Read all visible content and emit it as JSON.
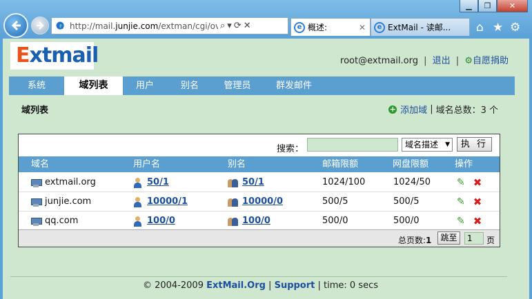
{
  "browser": {
    "window_buttons": [
      "▁",
      "❐",
      "✕"
    ],
    "url_prefix": "http://mail.",
    "url_domain": "junjie.com",
    "url_rest": "/extman/cgi/overv",
    "addr_buttons": [
      "⌕",
      "▾",
      "⟳",
      "✕"
    ],
    "tabs": [
      {
        "label": "概述:",
        "active": true
      },
      {
        "label": "ExtMail - 读邮...",
        "active": false
      }
    ],
    "toolbar_icons": [
      "home-icon",
      "favorites-icon",
      "tools-icon"
    ]
  },
  "app": {
    "logo": "Extmail",
    "user": "root@extmail.org",
    "logout": "退出",
    "donate": "自愿捐助"
  },
  "nav": {
    "items": [
      {
        "label": "系统",
        "active": false
      },
      {
        "label": "域列表",
        "active": true
      },
      {
        "label": "用户",
        "active": false
      },
      {
        "label": "别名",
        "active": false
      },
      {
        "label": "管理员",
        "active": false
      },
      {
        "label": "群发邮件",
        "active": false
      }
    ]
  },
  "section": {
    "title": "域列表",
    "add_label": "添加域",
    "total_label": "域名总数：",
    "total": "3 个"
  },
  "search": {
    "label": "搜索：",
    "value": "",
    "select_value": "域名描述",
    "button": "执 行"
  },
  "table": {
    "columns": [
      "域名",
      "用户名",
      "别名",
      "邮箱限额",
      "网盘限额",
      "操作"
    ],
    "rows": [
      {
        "domain": "extmail.org",
        "users": "50/1",
        "aliases": "50/1",
        "mailbox": "1024/100",
        "netdisk": "1024/50"
      },
      {
        "domain": "junjie.com",
        "users": "10000/1",
        "aliases": "10000/0",
        "mailbox": "500/5",
        "netdisk": "500/5"
      },
      {
        "domain": "qq.com",
        "users": "100/0",
        "aliases": "100/0",
        "mailbox": "500/0",
        "netdisk": "500/0"
      }
    ]
  },
  "pager": {
    "total_label": "总页数:",
    "total": "1",
    "go_button": "跳至",
    "page_value": "1",
    "unit": "页"
  },
  "footer": {
    "copyright": "© 2004-2009 ",
    "brand": "ExtMail.Org",
    "sep1": " | ",
    "support": "Support",
    "sep2": " | time: 0 secs"
  },
  "colors": {
    "page_bg": "#cfe6cf",
    "nav_bg": "#5b9fd0",
    "link": "#1c4f9c",
    "logo_e": "#e8541c",
    "logo_rest": "#1b5fb0"
  }
}
